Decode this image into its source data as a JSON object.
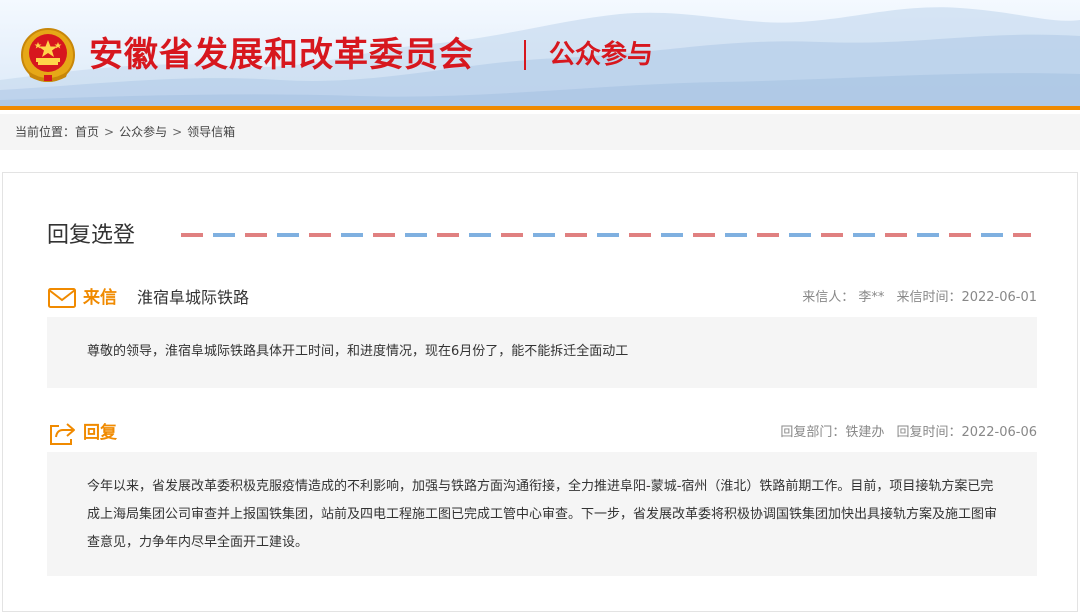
{
  "header": {
    "site_title": "安徽省发展和改革委员会",
    "section": "公众参与",
    "colors": {
      "brand_red": "#d7171e",
      "accent_orange": "#f08a00"
    }
  },
  "breadcrumb": {
    "prefix": "当前位置：",
    "items": [
      "首页",
      "公众参与",
      "领导信箱"
    ],
    "separator": ">"
  },
  "main": {
    "section_title": "回复选登",
    "letter": {
      "icon": "envelope-icon",
      "kind": "来信",
      "subject": "淮宿阜城际铁路",
      "sender": "来信人：  李**",
      "time": "来信时间：2022-06-01",
      "body": "尊敬的领导，淮宿阜城际铁路具体开工时间，和进度情况，现在6月份了，能不能拆迁全面动工"
    },
    "reply": {
      "icon": "share-reply-icon",
      "kind": "回复",
      "department": "回复部门：铁建办",
      "time": "回复时间：2022-06-06",
      "body": "今年以来，省发展改革委积极克服疫情造成的不利影响，加强与铁路方面沟通衔接，全力推进阜阳-蒙城-宿州（淮北）铁路前期工作。目前，项目接轨方案已完成上海局集团公司审查并上报国铁集团，站前及四电工程施工图已完成工管中心审查。下一步，省发展改革委将积极协调国铁集团加快出具接轨方案及施工图审查意见，力争年内尽早全面开工建设。"
    }
  }
}
